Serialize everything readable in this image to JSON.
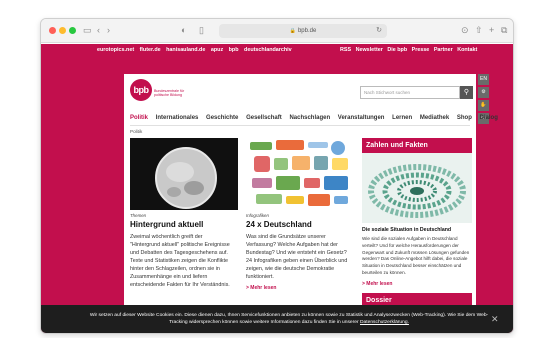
{
  "browser": {
    "url": "bpb.de"
  },
  "site": {
    "top_links_left": [
      "eurotopics.net",
      "fluter.de",
      "hanisauland.de",
      "apuz",
      "bpb",
      "deutschlandarchiv"
    ],
    "top_links_right": [
      "RSS",
      "Newsletter",
      "Die bpb",
      "Presse",
      "Partner",
      "Kontakt"
    ],
    "logo_mark": "bpb",
    "logo_text": "Bundeszentrale für politische Bildung",
    "search_placeholder": "Nach Stichwort suchen",
    "main_nav": [
      "Politik",
      "Internationales",
      "Geschichte",
      "Gesellschaft",
      "Nachschlagen",
      "Veranstaltungen",
      "Lernen",
      "Mediathek",
      "Shop",
      "Dialog"
    ],
    "breadcrumb": "Politik",
    "side_icons": [
      "EN",
      "⚙",
      "✋",
      "▭"
    ]
  },
  "teasers": [
    {
      "kicker": "Themen",
      "heading": "Hintergrund aktuell",
      "body": "Zweimal wöchentlich greift der \"Hintergrund aktuell\" politische Ereignisse und Debatten des Tagesgeschehens auf. Texte und Statistiken zeigen die Konflikte hinter den Schlagzeilen, ordnen sie in Zusammenhänge ein und liefern entscheidende Fakten für Ihr Verständnis."
    },
    {
      "kicker": "Infografiken",
      "heading": "24 x Deutschland",
      "body": "Was sind die Grundsätze unserer Verfassung? Welche Aufgaben hat der Bundestag? Und wie entsteht ein Gesetz? 24 Infografiken geben einen Überblick und zeigen, wie die deutsche Demokratie funktioniert.",
      "more": "> Mehr lesen"
    }
  ],
  "right_column": {
    "header": "Zahlen und Fakten",
    "title": "Die soziale Situation in Deutschland",
    "body": "Wie sind die sozialen Aufgaben in Deutschland verteilt? Und für welche Herausforderungen der Gegenwart und Zukunft müssen Lösungen gefunden werden? Das Online-Angebot hilft dabei, die soziale Situation in Deutschland besser einschätzen und beurteilen zu können.",
    "more": "> Mehr lesen",
    "header2": "Dossier"
  },
  "cookie": {
    "text": "Wir setzen auf dieser Website Cookies ein. Diese dienen dazu, Ihnen Servicefunktionen anbieten zu können sowie zu Statistik und Analysezwecken (Web-Tracking). Wie Sie dem Web-Tracking widersprechen können sowie weitere Informationen dazu finden Sie in unserer",
    "link": "Datenschutzerklärung.",
    "close": "✕"
  },
  "colors": {
    "brand": "#c20f4d"
  }
}
